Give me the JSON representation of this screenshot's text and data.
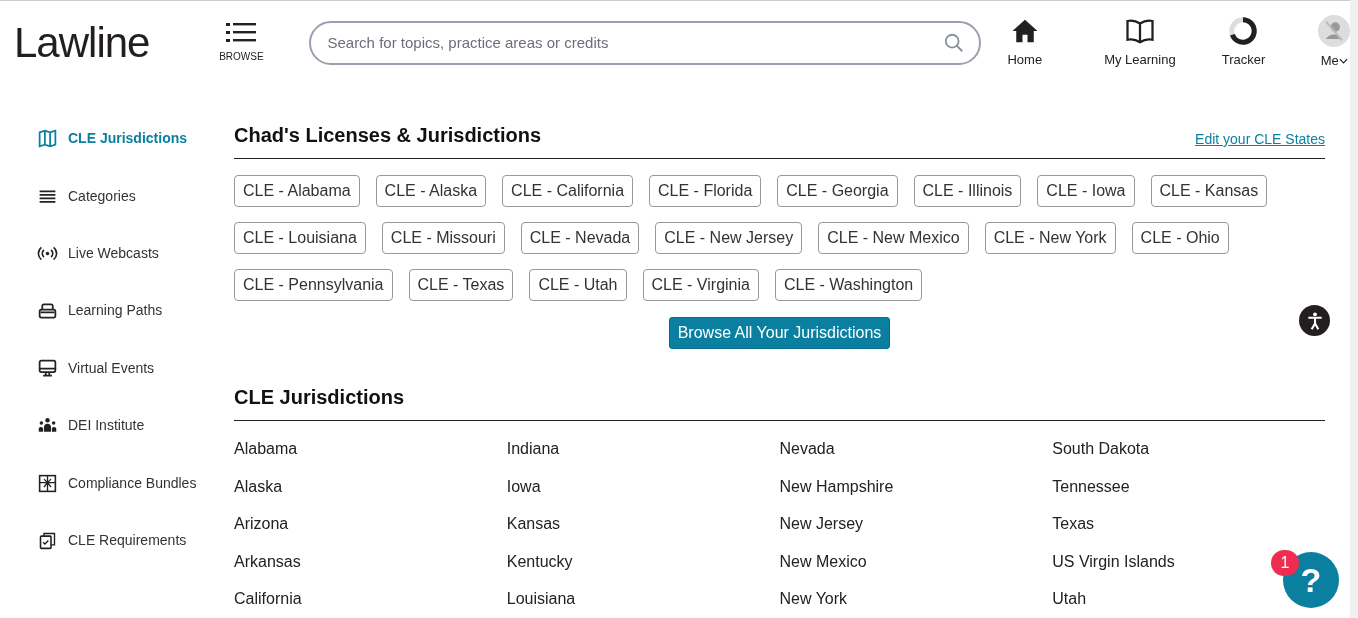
{
  "header": {
    "logo": "Lawline",
    "browse": "BROWSE",
    "search": {
      "placeholder": "Search for topics, practice areas or credits"
    },
    "nav": [
      {
        "label": "Home"
      },
      {
        "label": "My Learning"
      },
      {
        "label": "Tracker"
      },
      {
        "label": "Me"
      }
    ]
  },
  "sidebar": {
    "items": [
      {
        "label": "CLE Jurisdictions",
        "selected": true
      },
      {
        "label": "Categories",
        "selected": false
      },
      {
        "label": "Live Webcasts",
        "selected": false
      },
      {
        "label": "Learning Paths",
        "selected": false
      },
      {
        "label": "Virtual Events",
        "selected": false
      },
      {
        "label": "DEI Institute",
        "selected": false
      },
      {
        "label": "Compliance Bundles",
        "selected": false
      },
      {
        "label": "CLE Requirements",
        "selected": false
      }
    ]
  },
  "licenses": {
    "title": "Chad's Licenses & Jurisdictions",
    "edit_link": "Edit your CLE States",
    "tags": [
      "CLE - Alabama",
      "CLE - Alaska",
      "CLE - California",
      "CLE - Florida",
      "CLE - Georgia",
      "CLE - Illinois",
      "CLE - Iowa",
      "CLE - Kansas",
      "CLE - Louisiana",
      "CLE - Missouri",
      "CLE - Nevada",
      "CLE - New Jersey",
      "CLE - New Mexico",
      "CLE - New York",
      "CLE - Ohio",
      "CLE - Pennsylvania",
      "CLE - Texas",
      "CLE - Utah",
      "CLE - Virginia",
      "CLE - Washington"
    ],
    "button": "Browse All Your Jurisdictions"
  },
  "jurisdictions": {
    "title": "CLE Jurisdictions",
    "columns": [
      [
        "Alabama",
        "Alaska",
        "Arizona",
        "Arkansas",
        "California"
      ],
      [
        "Indiana",
        "Iowa",
        "Kansas",
        "Kentucky",
        "Louisiana"
      ],
      [
        "Nevada",
        "New Hampshire",
        "New Jersey",
        "New Mexico",
        "New York"
      ],
      [
        "South Dakota",
        "Tennessee",
        "Texas",
        "US Virgin Islands",
        "Utah"
      ]
    ]
  },
  "help": {
    "label": "?",
    "badge": "1"
  }
}
